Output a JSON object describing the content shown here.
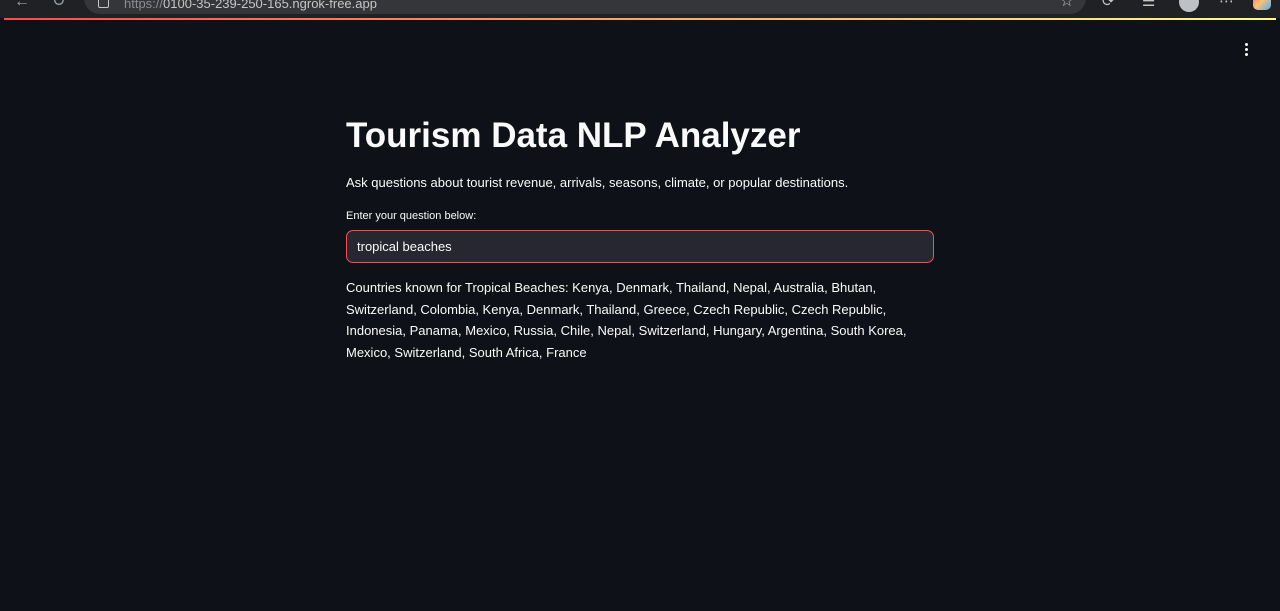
{
  "browser": {
    "url_scheme": "https://",
    "url_host": "0100-35-239-250-165.ngrok-free.app",
    "back_icon": "back-arrow-icon",
    "reload_icon": "reload-icon",
    "star_icon": "star-icon",
    "menu_icon": "more-icon"
  },
  "app": {
    "title": "Tourism Data NLP Analyzer",
    "subtitle": "Ask questions about tourist revenue, arrivals, seasons, climate, or popular destinations.",
    "input": {
      "label": "Enter your question below:",
      "value": "tropical beaches"
    },
    "answer": "Countries known for Tropical Beaches: Kenya, Denmark, Thailand, Nepal, Australia, Bhutan, Switzerland, Colombia, Kenya, Denmark, Thailand, Greece, Czech Republic, Czech Republic, Indonesia, Panama, Mexico, Russia, Chile, Nepal, Switzerland, Hungary, Argentina, South Korea, Mexico, Switzerland, South Africa, France",
    "menu_icon": "kebab-menu-icon"
  },
  "colors": {
    "background": "#0e1117",
    "text": "#fafafa",
    "input_background": "#262730",
    "focus_border": "#ff4b4b"
  }
}
